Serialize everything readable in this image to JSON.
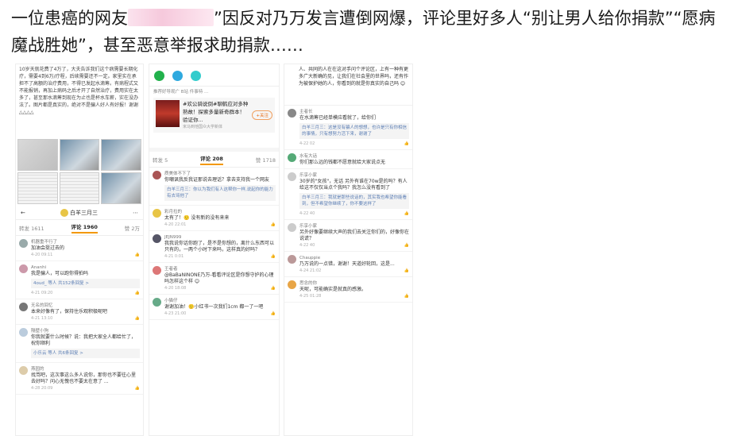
{
  "headline": {
    "part1": "一位患癌的网友",
    "part2": "”因反对乃万发言遭倒网爆，评论里好多人“别让男人给你捐款”“愿病魔战胜她”，甚至恶意举报求助捐款……"
  },
  "panel1": {
    "post_text": "10岁天就花费了4万了，大夫告诉我们这个病需要长期化疗，需要4到6万/疗程，后续需要还不一定。家里实在承担不了高额的治疗费用，不得已发起水滴筹。有病程式又不能报销，再加上病码之后才开了自然治疗，费用实在太多了，甚至那水滴筹到现在为止也是杯水车薪，实在没办法了。图片都是真实的，绝对不是骗人好人有好报！谢谢△△△△",
    "account": "白羊三月三",
    "tabs": {
      "repost": "转发 1611",
      "comment": "评论 1960",
      "like": "赞 2万"
    },
    "comments": [
      {
        "name": "机器重不行了",
        "text": "加油会挺过去的",
        "time": "4-20 09:11",
        "likes": ""
      },
      {
        "name": "Ananhi",
        "text": "我是骗人，可以跑你得拍吗",
        "time": "4-21 09:20",
        "likes": "",
        "reply": "4oud_  等人 共152条回复 >"
      },
      {
        "name": "无名的回忆",
        "text": "本来好像有了，保持住乐观积极呢吧",
        "time": "4-21 13:10",
        "likes": ""
      },
      {
        "name": "隔壁小狗",
        "text": "你我就要什么时候？说：我把大家全人都给忙了，祝你顺利",
        "time": "",
        "likes": "",
        "reply": "小乐云 等人 共6条回复 >"
      },
      {
        "name": "燕园的",
        "text": "找骂吧，这次事这么多人说你，那你也不要往心里去好吗？问心无愧也不要太在意了 ...",
        "time": "4-28 20:09",
        "likes": ""
      }
    ]
  },
  "panel2": {
    "ad_title": "推荐好导观广 B站 件事特 ...",
    "ad_text": "#欢公骑说倒#聊鹤应对多种熟故！探索多量新奇群本！验证你...",
    "ad_source": "米马到他国众大学新体",
    "ad_button": "+关注",
    "tabs": {
      "repost": "转发 5",
      "comment": "评论 208",
      "like": "赞 1718"
    },
    "comments": [
      {
        "name": "质美体不下了",
        "text": "你嘲讽我反我证那说去理话？拿去支持我一个网友",
        "time": "",
        "reply": "白羊三月三：你以为我们有人这帮你一样,说起你的能力有去骂他了"
      },
      {
        "name": "彩月拉的",
        "text": "太有了！🙂 没有新的没有来来",
        "time": "4-20 22:01",
        "reply": ""
      },
      {
        "name": "JEJN999",
        "text": "我我说你话你跑了，是不是你想的，离什么东西可以只有的，一两个小时下来吗，这样真的好吗？",
        "time": "4-21 0:01",
        "reply": ""
      },
      {
        "name": "王者者",
        "text": "@BaBaNINONE乃万-看看评论区是你想守护的心理吗怎样这个样 😊",
        "time": "4-20 18:08",
        "reply": ""
      },
      {
        "name": "小猫仔",
        "text": "谢谢加油！🙂小红书一次我们1cm 都一了一吧",
        "time": "4-23 21:00",
        "reply": ""
      }
    ]
  },
  "panel3": {
    "top_text": "人、共同的人在在这对手问个评论区，上有一种有更多广大新确的见，让我们在社会里的世界吗，还有作为被保护她的人，你看到的就是你真实的自己吗 😊",
    "comments": [
      {
        "name": "主者长",
        "text": "在水滴筹已经单模应看就了，给你们",
        "time": "4-22 02",
        "reply": "白羊三月三：这是没有骗人的想想，也许是只有你相信的事情，只有想努力活下来，谢谢了"
      },
      {
        "name": "水有大话",
        "text": "你们那么远的钱都不愿意就给大家说点无",
        "time": "4-22 40",
        "reply": ""
      },
      {
        "name": "乐享小家",
        "text": "30岁的\"女孩\"，无话 另外有谁在70w是的吗？有人给这不仅仅当点个我吗？我怎么没有看到了",
        "time": "4-22 40",
        "reply": "白羊三月三：我就是那些说话的，其实我也希望你能看到，但不希望你继续了，你不要这样了"
      },
      {
        "name": "乐享小家",
        "text": "另外好像要继续大声的我们去关注你们的，好像你在说谎？",
        "time": "4-22 40",
        "reply": ""
      },
      {
        "name": "Chauppie",
        "text": "乃万说的一点错，谢谢！天道好轮回，这是...",
        "time": "4-24 21:02",
        "reply": ""
      },
      {
        "name": "思念的你",
        "text": "天呢，可能确实是就真的感激。",
        "time": "4-25 01:28",
        "reply": ""
      }
    ]
  }
}
